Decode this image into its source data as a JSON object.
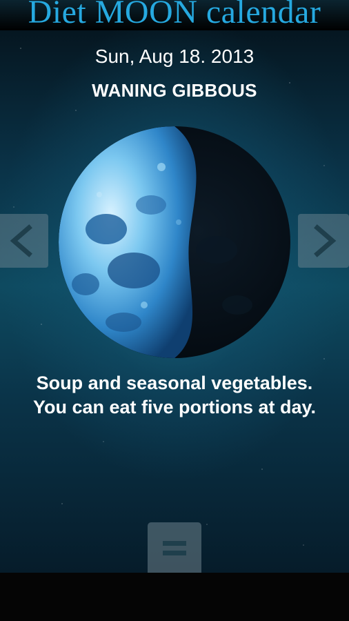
{
  "header": {
    "title_part1": "Diet",
    "title_part2": "MOON",
    "title_part3": "calendar"
  },
  "date": "Sun, Aug 18. 2013",
  "phase": "WANING GIBBOUS",
  "advice": {
    "line1": "Soup and seasonal vegetables.",
    "line2": "You can eat five portions at day."
  },
  "icons": {
    "prev": "chevron-left-icon",
    "next": "chevron-right-icon",
    "menu": "menu-icon",
    "moon": "moon-phase-image"
  },
  "colors": {
    "title": "#26a9e0",
    "text": "#ffffff",
    "background": "#0a3348"
  }
}
